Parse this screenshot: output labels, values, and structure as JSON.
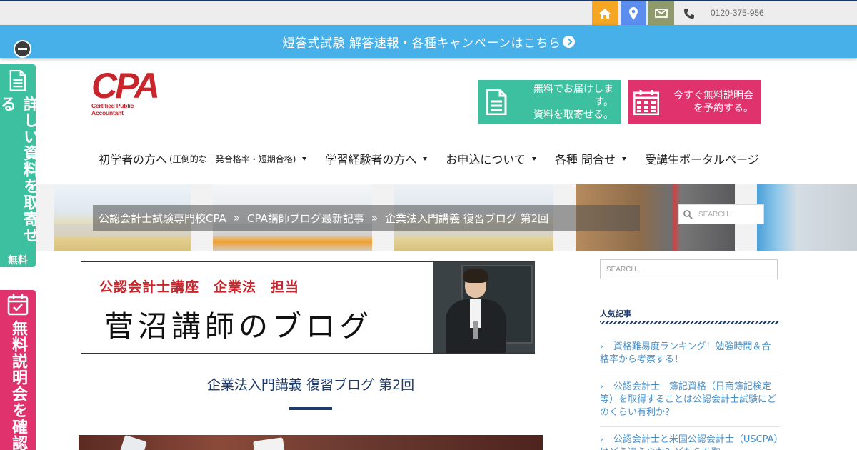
{
  "topbar": {
    "icons": [
      "home-icon",
      "map-pin-icon",
      "mail-icon",
      "phone-icon"
    ],
    "phone": "0120-375-956"
  },
  "announce": {
    "text": "短答式試験 解答速報・各種キャンペーンはこちら"
  },
  "side_tabs": {
    "document": {
      "vertical": "詳しい資料を取寄せる",
      "small": "無料"
    },
    "seminar": {
      "vertical": "無料説明会を確認"
    }
  },
  "logo": {
    "main": "CPA",
    "sub": "Certified Public Accountant"
  },
  "cta": {
    "document": {
      "line1": "無料でお届けします。",
      "line2": "資料を取寄せる。"
    },
    "seminar": {
      "line1": "今すぐ無料説明会",
      "line2": "を予約する。"
    }
  },
  "nav": {
    "items": [
      {
        "label": "初学者の方へ",
        "sub": "(圧倒的な一発合格率・短期合格)"
      },
      {
        "label": "学習経験者の方へ"
      },
      {
        "label": "お申込について"
      },
      {
        "label": "各種 問合せ"
      },
      {
        "label": "受講生ポータルページ"
      }
    ]
  },
  "breadcrumb": {
    "items": [
      "公認会計士試験専門校CPA",
      "CPA講師ブログ最新記事",
      "企業法入門講義 復習ブログ 第2回"
    ],
    "separator": "»"
  },
  "hero_search": {
    "placeholder": "SEARCH..."
  },
  "blog_banner": {
    "subtitle": "公認会計士講座　企業法　担当",
    "title": "菅沼講師のブログ"
  },
  "post": {
    "title": "企業法入門講義 復習ブログ 第2回"
  },
  "sidebar": {
    "search_placeholder": "SEARCH...",
    "popular_heading": "人気記事",
    "popular": [
      "資格難易度ランキング！勉強時間＆合格率から考察する！",
      "公認会計士　簿記資格（日商簿記検定等）を取得することは公認会計士試験にどのくらい有利か？",
      "公認会計士と米国公認会計士（USCPA）はどう違うのか？どちらを取"
    ]
  },
  "colors": {
    "accent_blue": "#48b0e8",
    "teal": "#3cc0a0",
    "pink": "#e0336e",
    "navy": "#1e3a6b",
    "logo_red": "#c8252c"
  }
}
